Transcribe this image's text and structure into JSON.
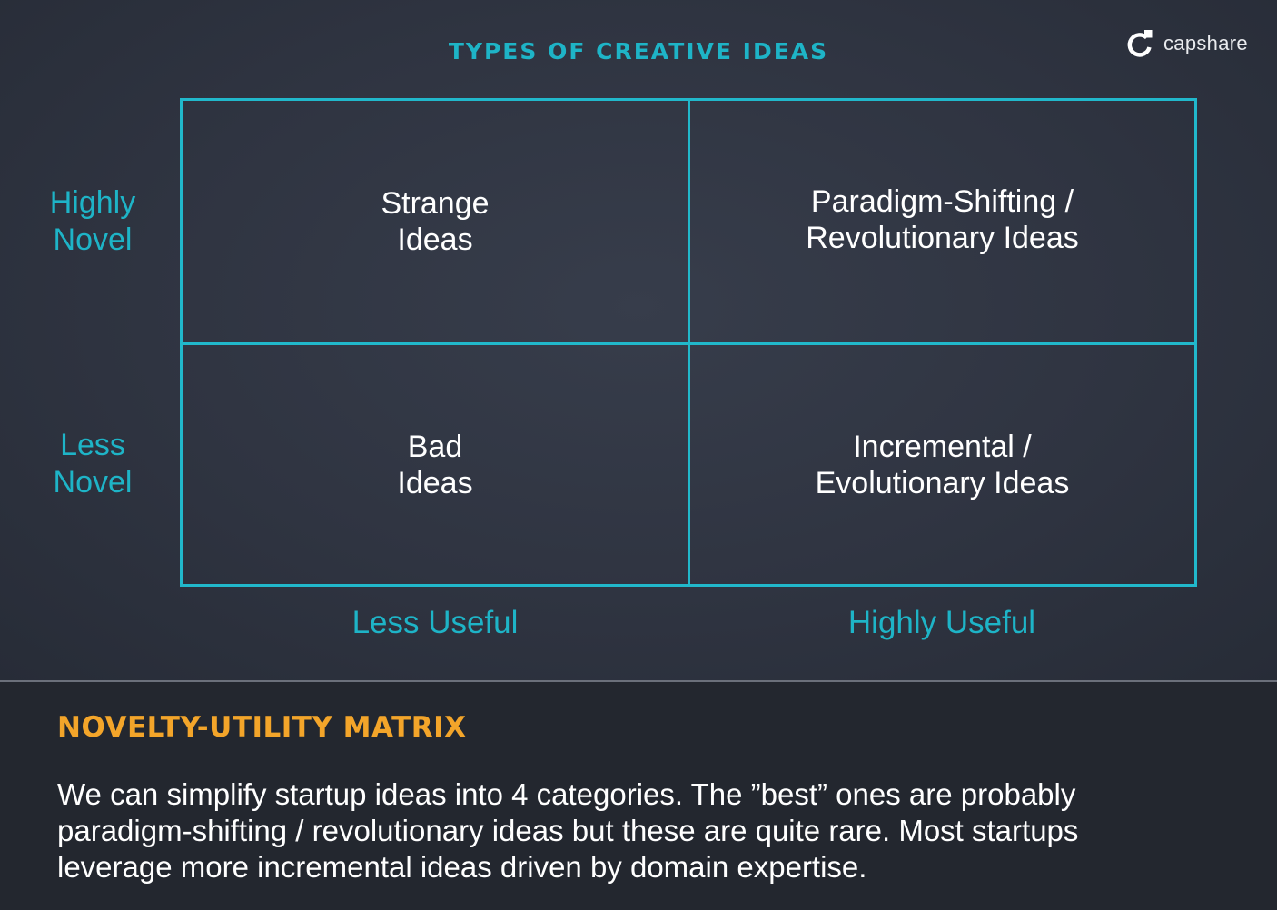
{
  "header": {
    "title": "TYPES OF CREATIVE IDEAS",
    "logo_text": "capshare"
  },
  "matrix": {
    "y_labels": [
      {
        "line1": "Highly",
        "line2": "Novel"
      },
      {
        "line1": "Less",
        "line2": "Novel"
      }
    ],
    "x_labels": [
      "Less Useful",
      "Highly Useful"
    ],
    "cells": {
      "top_left": {
        "line1": "Strange",
        "line2": "Ideas"
      },
      "top_right": {
        "line1": "Paradigm-Shifting /",
        "line2": "Revolutionary Ideas"
      },
      "bottom_left": {
        "line1": "Bad",
        "line2": "Ideas"
      },
      "bottom_right": {
        "line1": "Incremental /",
        "line2": "Evolutionary Ideas"
      }
    }
  },
  "footer": {
    "section_title": "NOVELTY-UTILITY MATRIX",
    "body_lines": [
      "We can simplify startup ideas into 4 categories.  The ”best” ones are probably",
      "paradigm-shifting / revolutionary ideas but these are quite rare.  Most startups",
      "leverage more incremental ideas driven by domain expertise."
    ]
  },
  "colors": {
    "accent_teal": "#21b8cb",
    "accent_orange": "#f3a52a",
    "background": "#2f3441",
    "text": "#ffffff"
  },
  "icons": {
    "logo": "capshare-logo-icon"
  }
}
